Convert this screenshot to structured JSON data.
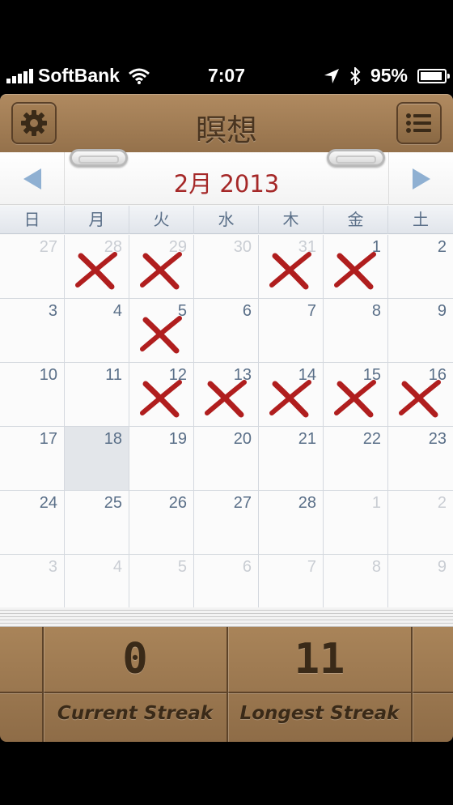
{
  "status_bar": {
    "carrier": "SoftBank",
    "time": "7:07",
    "battery": "95%"
  },
  "header": {
    "title": "瞑想",
    "settings_icon": "gear-icon",
    "menu_icon": "list-icon"
  },
  "calendar": {
    "month_title": "2月 2013",
    "weekdays": [
      "日",
      "月",
      "火",
      "水",
      "木",
      "金",
      "土"
    ],
    "weeks": [
      [
        {
          "day": "27",
          "other": true,
          "x": false
        },
        {
          "day": "28",
          "other": true,
          "x": true
        },
        {
          "day": "29",
          "other": true,
          "x": true
        },
        {
          "day": "30",
          "other": true,
          "x": false
        },
        {
          "day": "31",
          "other": true,
          "x": true
        },
        {
          "day": "1",
          "other": false,
          "x": true
        },
        {
          "day": "2",
          "other": false,
          "x": false
        }
      ],
      [
        {
          "day": "3",
          "other": false,
          "x": false
        },
        {
          "day": "4",
          "other": false,
          "x": false
        },
        {
          "day": "5",
          "other": false,
          "x": true
        },
        {
          "day": "6",
          "other": false,
          "x": false
        },
        {
          "day": "7",
          "other": false,
          "x": false
        },
        {
          "day": "8",
          "other": false,
          "x": false
        },
        {
          "day": "9",
          "other": false,
          "x": false
        }
      ],
      [
        {
          "day": "10",
          "other": false,
          "x": false
        },
        {
          "day": "11",
          "other": false,
          "x": false
        },
        {
          "day": "12",
          "other": false,
          "x": true
        },
        {
          "day": "13",
          "other": false,
          "x": true
        },
        {
          "day": "14",
          "other": false,
          "x": true
        },
        {
          "day": "15",
          "other": false,
          "x": true
        },
        {
          "day": "16",
          "other": false,
          "x": true
        }
      ],
      [
        {
          "day": "17",
          "other": false,
          "x": false
        },
        {
          "day": "18",
          "other": false,
          "x": false,
          "today": true
        },
        {
          "day": "19",
          "other": false,
          "x": false
        },
        {
          "day": "20",
          "other": false,
          "x": false
        },
        {
          "day": "21",
          "other": false,
          "x": false
        },
        {
          "day": "22",
          "other": false,
          "x": false
        },
        {
          "day": "23",
          "other": false,
          "x": false
        }
      ],
      [
        {
          "day": "24",
          "other": false,
          "x": false
        },
        {
          "day": "25",
          "other": false,
          "x": false
        },
        {
          "day": "26",
          "other": false,
          "x": false
        },
        {
          "day": "27",
          "other": false,
          "x": false
        },
        {
          "day": "28",
          "other": false,
          "x": false
        },
        {
          "day": "1",
          "other": true,
          "x": false
        },
        {
          "day": "2",
          "other": true,
          "x": false
        }
      ],
      [
        {
          "day": "3",
          "other": true,
          "x": false
        },
        {
          "day": "4",
          "other": true,
          "x": false
        },
        {
          "day": "5",
          "other": true,
          "x": false
        },
        {
          "day": "6",
          "other": true,
          "x": false
        },
        {
          "day": "7",
          "other": true,
          "x": false
        },
        {
          "day": "8",
          "other": true,
          "x": false
        },
        {
          "day": "9",
          "other": true,
          "x": false
        }
      ]
    ]
  },
  "stats": {
    "current_streak_value": "0",
    "current_streak_label": "Current Streak",
    "longest_streak_value": "11",
    "longest_streak_label": "Longest Streak"
  },
  "colors": {
    "accent_red": "#a52828",
    "x_mark": "#b01e1e",
    "wood": "#9c7850"
  }
}
